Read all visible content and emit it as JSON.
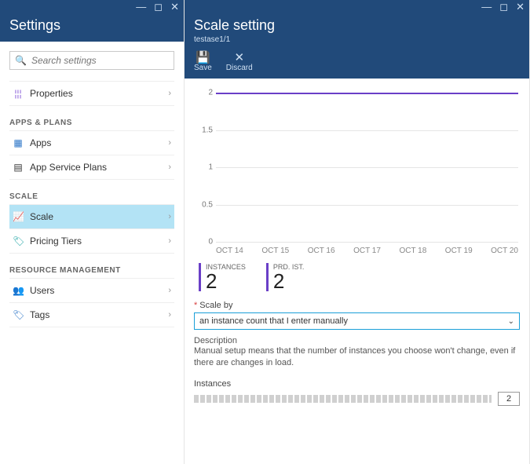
{
  "left": {
    "title": "Settings",
    "search_placeholder": "Search settings",
    "item_properties": "Properties",
    "section_apps": "APPS & PLANS",
    "item_apps": "Apps",
    "item_asp": "App Service Plans",
    "section_scale": "SCALE",
    "item_scale": "Scale",
    "item_pricing": "Pricing Tiers",
    "section_rm": "RESOURCE MANAGEMENT",
    "item_users": "Users",
    "item_tags": "Tags"
  },
  "right": {
    "title": "Scale setting",
    "subtitle": "testase1/1",
    "save_label": "Save",
    "discard_label": "Discard",
    "metric_instances_label": "INSTANCES",
    "metric_instances_value": "2",
    "metric_prd_label": "PRD. IST.",
    "metric_prd_value": "2",
    "scale_by_label": "Scale by",
    "scale_by_value": "an instance count that I enter manually",
    "desc_head": "Description",
    "desc_body": "Manual setup means that the number of instances you choose won't change, even if there are changes in load.",
    "instances_label": "Instances",
    "instances_value": "2"
  },
  "chart_data": {
    "type": "line",
    "y_ticks": [
      "2",
      "1.5",
      "1",
      "0.5",
      "0"
    ],
    "ylim": [
      0,
      2
    ],
    "x_ticks": [
      "OCT 14",
      "OCT 15",
      "OCT 16",
      "OCT 17",
      "OCT 18",
      "OCT 19",
      "OCT 20"
    ],
    "series": [
      {
        "name": "INSTANCES",
        "value_constant": 2,
        "color": "#6a3fc7"
      },
      {
        "name": "PRD. IST.",
        "value_constant": 2,
        "color": "#6a3fc7"
      }
    ]
  }
}
